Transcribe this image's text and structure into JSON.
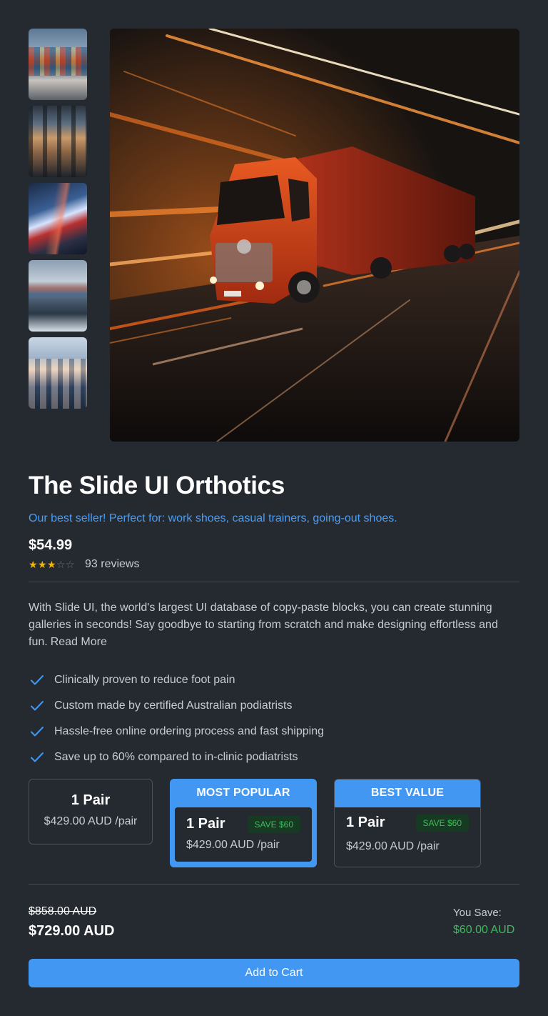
{
  "gallery": {
    "thumbnails": [
      {
        "icon": "cargo-containers-image"
      },
      {
        "icon": "warehouse-image"
      },
      {
        "icon": "red-truck-image"
      },
      {
        "icon": "cargo-ship-image"
      },
      {
        "icon": "team-photo-image"
      }
    ],
    "main_image": "speeding-red-truck-image"
  },
  "product": {
    "title": "The Slide UI Orthotics",
    "subtitle": "Our best seller! Perfect for: work shoes, casual trainers, going-out shoes.",
    "price": "$54.99",
    "rating": 3,
    "rating_max": 5,
    "reviews": "93 reviews",
    "description": "With Slide UI, the world's largest UI database of copy-paste blocks, you can create stunning galleries in seconds! Say goodbye to starting from scratch and make designing effortless and fun.",
    "read_more": "Read More",
    "features": [
      "Clinically proven to reduce foot pain",
      "Custom made by certified Australian podiatrists",
      "Hassle-free online ordering process and fast shipping",
      "Save up to 60% compared to in-clinic podiatrists"
    ]
  },
  "options": [
    {
      "qty": "1 Pair",
      "price": "$429.00 AUD /pair"
    },
    {
      "badge": "MOST POPULAR",
      "qty": "1 Pair",
      "price": "$429.00 AUD /pair",
      "save": "SAVE $60"
    },
    {
      "badge": "BEST VALUE",
      "qty": "1 Pair",
      "price": "$429.00 AUD /pair",
      "save": "SAVE $60"
    }
  ],
  "totals": {
    "old_price": "$858.00 AUD",
    "new_price": "$729.00 AUD",
    "you_save_label": "You Save:",
    "you_save_amount": "$60.00 AUD"
  },
  "cart_button": "Add to Cart",
  "colors": {
    "accent": "#4197f2",
    "link": "#4b9ef5",
    "success": "#3dbb5b",
    "star": "#f5b800",
    "background": "#252a31"
  }
}
